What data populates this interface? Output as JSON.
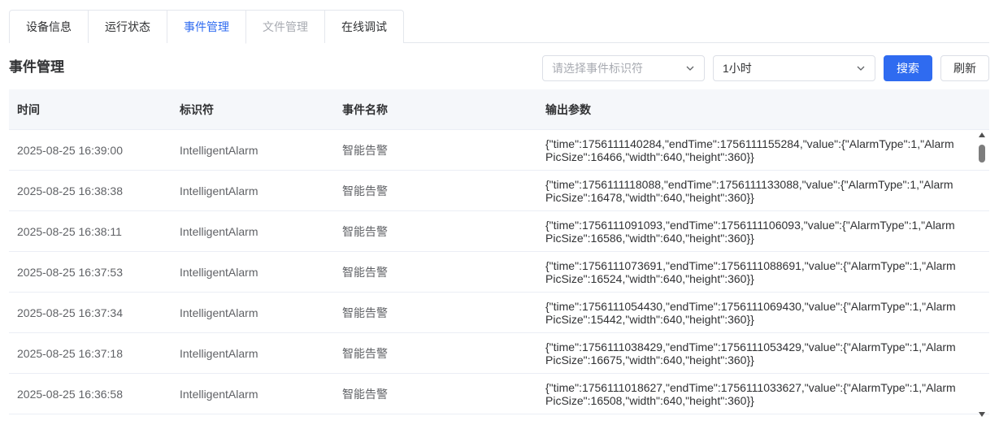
{
  "tabs": [
    {
      "label": "设备信息",
      "state": "normal"
    },
    {
      "label": "运行状态",
      "state": "normal"
    },
    {
      "label": "事件管理",
      "state": "active"
    },
    {
      "label": "文件管理",
      "state": "disabled"
    },
    {
      "label": "在线调试",
      "state": "normal"
    }
  ],
  "toolbar": {
    "title": "事件管理",
    "event_select_placeholder": "请选择事件标识符",
    "range_select_value": "1小时",
    "search_label": "搜索",
    "refresh_label": "刷新"
  },
  "table": {
    "headers": [
      "时间",
      "标识符",
      "事件名称",
      "输出参数"
    ],
    "rows": [
      {
        "time": "2025-08-25 16:39:00",
        "identifier": "IntelligentAlarm",
        "name": "智能告警",
        "output": "{\"time\":1756111140284,\"endTime\":1756111155284,\"value\":{\"AlarmType\":1,\"AlarmPicSize\":16466,\"width\":640,\"height\":360}}"
      },
      {
        "time": "2025-08-25 16:38:38",
        "identifier": "IntelligentAlarm",
        "name": "智能告警",
        "output": "{\"time\":1756111118088,\"endTime\":1756111133088,\"value\":{\"AlarmType\":1,\"AlarmPicSize\":16478,\"width\":640,\"height\":360}}"
      },
      {
        "time": "2025-08-25 16:38:11",
        "identifier": "IntelligentAlarm",
        "name": "智能告警",
        "output": "{\"time\":1756111091093,\"endTime\":1756111106093,\"value\":{\"AlarmType\":1,\"AlarmPicSize\":16586,\"width\":640,\"height\":360}}"
      },
      {
        "time": "2025-08-25 16:37:53",
        "identifier": "IntelligentAlarm",
        "name": "智能告警",
        "output": "{\"time\":1756111073691,\"endTime\":1756111088691,\"value\":{\"AlarmType\":1,\"AlarmPicSize\":16524,\"width\":640,\"height\":360}}"
      },
      {
        "time": "2025-08-25 16:37:34",
        "identifier": "IntelligentAlarm",
        "name": "智能告警",
        "output": "{\"time\":1756111054430,\"endTime\":1756111069430,\"value\":{\"AlarmType\":1,\"AlarmPicSize\":15442,\"width\":640,\"height\":360}}"
      },
      {
        "time": "2025-08-25 16:37:18",
        "identifier": "IntelligentAlarm",
        "name": "智能告警",
        "output": "{\"time\":1756111038429,\"endTime\":1756111053429,\"value\":{\"AlarmType\":1,\"AlarmPicSize\":16675,\"width\":640,\"height\":360}}"
      },
      {
        "time": "2025-08-25 16:36:58",
        "identifier": "IntelligentAlarm",
        "name": "智能告警",
        "output": "{\"time\":1756111018627,\"endTime\":1756111033627,\"value\":{\"AlarmType\":1,\"AlarmPicSize\":16508,\"width\":640,\"height\":360}}"
      }
    ]
  },
  "colors": {
    "accent": "#2f6bf0",
    "disabled": "#a8abb2",
    "border": "#e4e7ed",
    "header_bg": "#f5f7fa"
  },
  "icons": {
    "select_chevron": "chevron-down-icon"
  }
}
